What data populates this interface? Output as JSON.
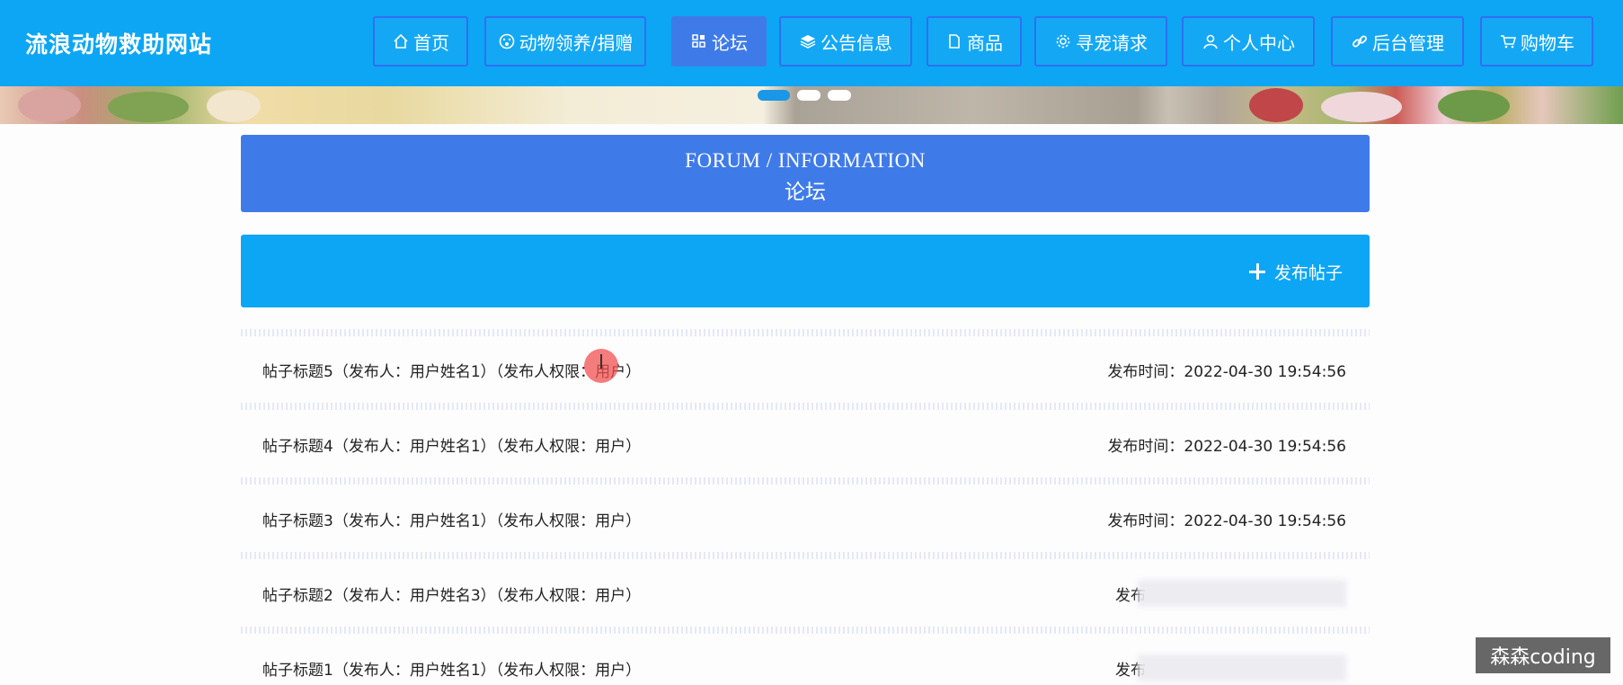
{
  "site": {
    "title": "流浪动物救助网站"
  },
  "nav": {
    "items": [
      {
        "label": "首页",
        "icon": "home-icon"
      },
      {
        "label": "动物领养/捐赠",
        "icon": "paw-icon"
      },
      {
        "label": "论坛",
        "icon": "grid-icon",
        "active": true
      },
      {
        "label": "公告信息",
        "icon": "layers-icon"
      },
      {
        "label": "商品",
        "icon": "document-icon"
      },
      {
        "label": "寻宠请求",
        "icon": "gear-icon"
      },
      {
        "label": "个人中心",
        "icon": "user-icon"
      },
      {
        "label": "后台管理",
        "icon": "link-icon"
      },
      {
        "label": "购物车",
        "icon": "cart-icon"
      }
    ]
  },
  "section": {
    "title_en": "FORUM / INFORMATION",
    "title_cn": "论坛"
  },
  "actions": {
    "publish_label": "发布帖子"
  },
  "posts": [
    {
      "title": "帖子标题5（发布人：用户姓名1）（发布人权限：用户）",
      "time": "发布时间：2022-04-30 19:54:56"
    },
    {
      "title": "帖子标题4（发布人：用户姓名1）（发布人权限：用户）",
      "time": "发布时间：2022-04-30 19:54:56"
    },
    {
      "title": "帖子标题3（发布人：用户姓名1）（发布人权限：用户）",
      "time": "发布时间：2022-04-30 19:54:56"
    },
    {
      "title": "帖子标题2（发布人：用户姓名3）（发布人权限：用户）",
      "time": "发布"
    },
    {
      "title": "帖子标题1（发布人：用户姓名1）（发布人权限：用户）",
      "time": "发布"
    }
  ],
  "watermark": "森森coding",
  "colors": {
    "primary": "#0da6f4",
    "accent": "#3f7be8"
  }
}
